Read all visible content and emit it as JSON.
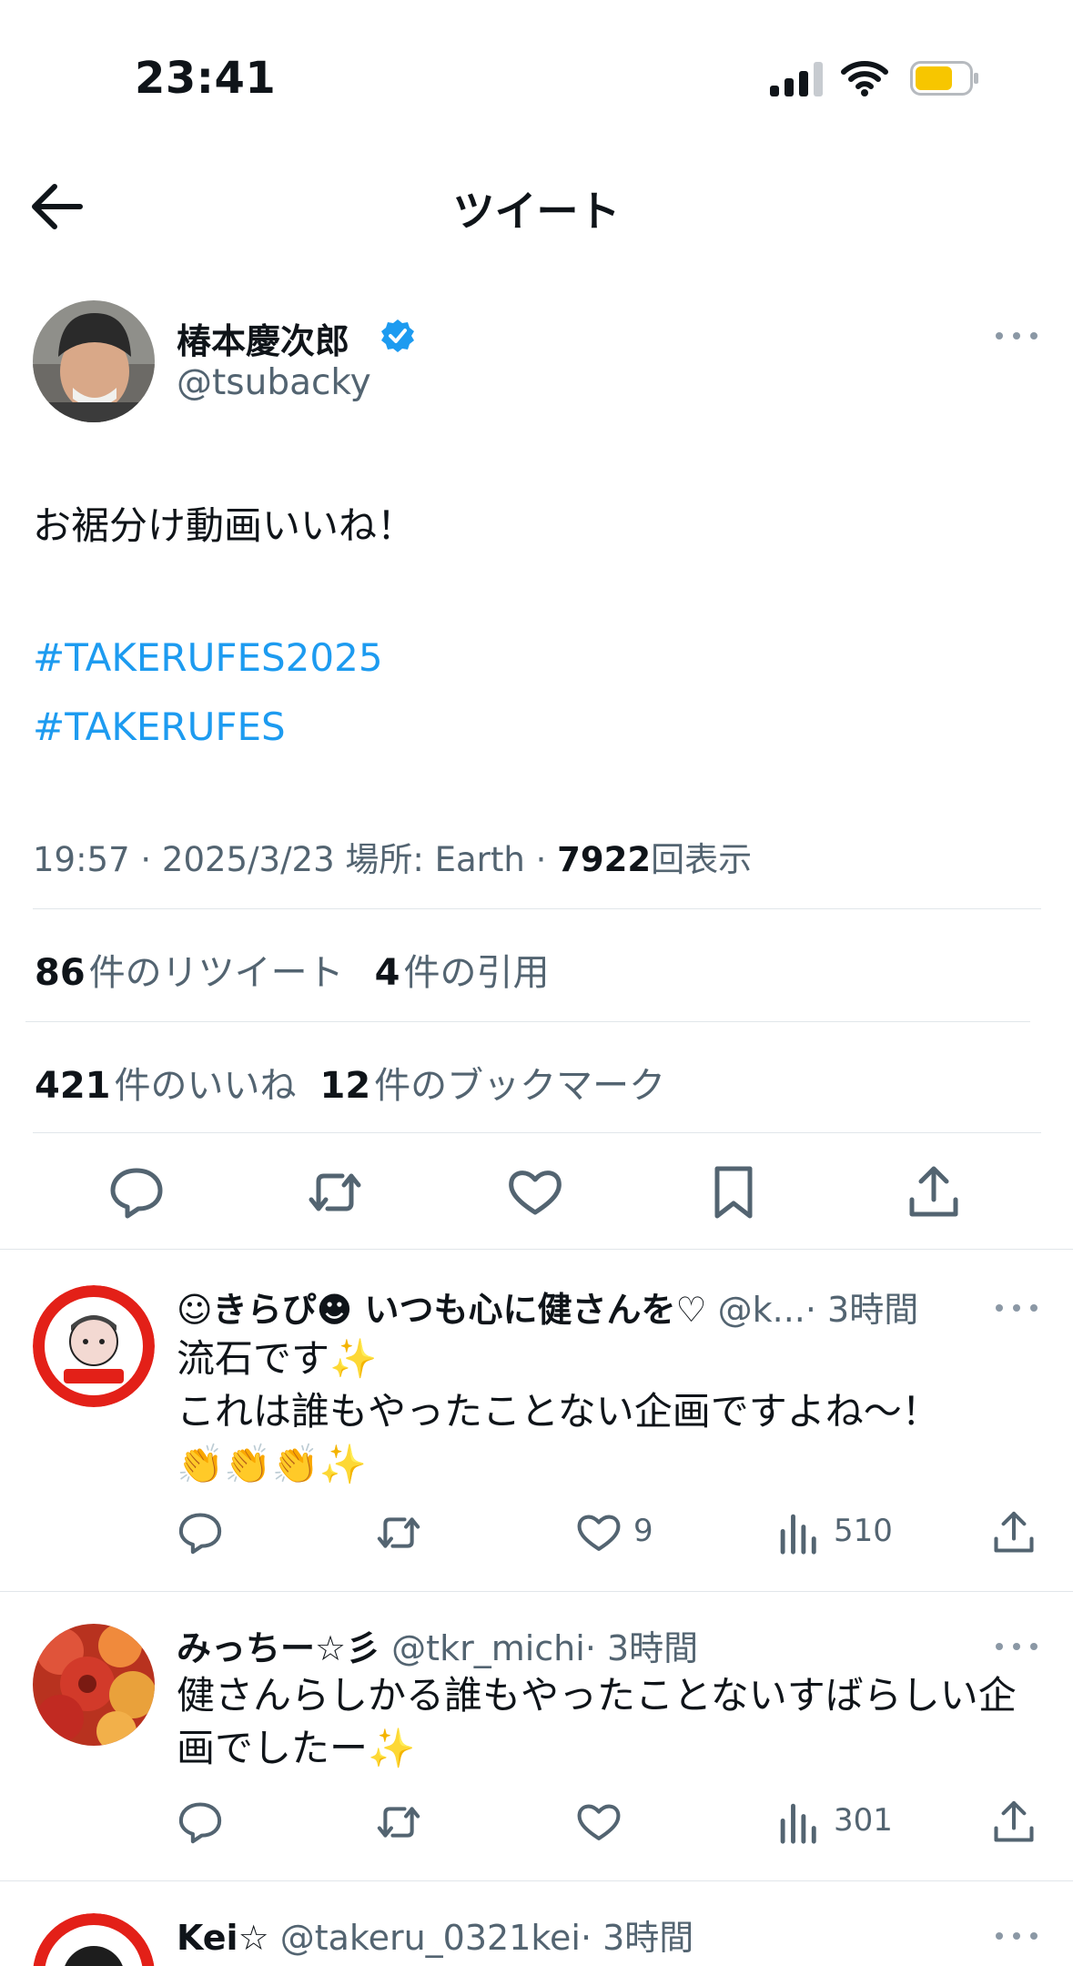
{
  "status_bar": {
    "time": "23:41",
    "battery_color": "#f7c600"
  },
  "nav": {
    "title": "ツイート"
  },
  "tweet": {
    "author_name": "椿本慶次郎",
    "author_handle": "@tsubacky",
    "text": "お裾分け動画いいね！",
    "hashtags": [
      "#TAKERUFES2025",
      "#TAKERUFES"
    ],
    "meta": {
      "time": "19:57 · 2025/3/23 場所: Earth · ",
      "views": "7922",
      "views_label": "回表示"
    },
    "stats": {
      "retweets": "86",
      "retweets_label": "件のリツイート",
      "quotes": "4",
      "quotes_label": "件の引用",
      "likes": "421",
      "likes_label": "件のいいね",
      "bookmarks": "12",
      "bookmarks_label": "件のブックマーク"
    }
  },
  "replies": [
    {
      "name": "☺︎きらぴ☻ いつも心に健さんを♡",
      "handle": "@k...",
      "time": "· 3時間",
      "lines": [
        "流石です✨",
        "これは誰もやったことない企画ですよね〜！",
        "👏👏👏✨"
      ],
      "likes": "9",
      "views": "510"
    },
    {
      "name": "みっちー☆彡",
      "handle": "@tkr_michi",
      "time": "· 3時間",
      "lines": [
        "健さんらしかる誰もやったことないすばらしい企",
        "画でしたー✨"
      ],
      "likes": "",
      "views": "301"
    },
    {
      "name": "Kei☆",
      "handle": "@takeru_0321kei",
      "time": "· 3時間"
    }
  ],
  "colors": {
    "accent": "#1d9bf0",
    "secondary_text": "#536471",
    "icon": "#536471"
  }
}
